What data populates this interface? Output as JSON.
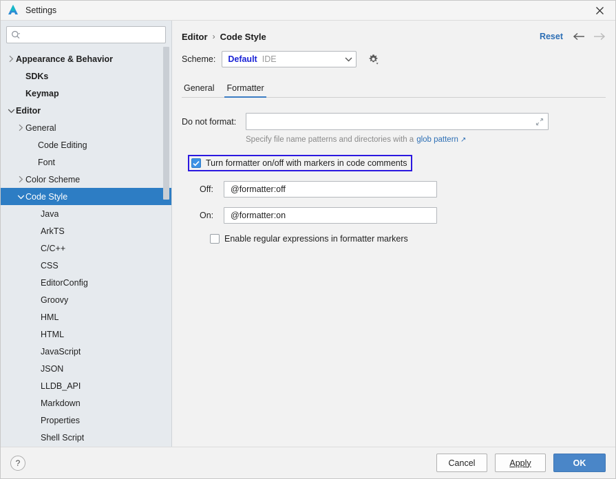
{
  "window": {
    "title": "Settings",
    "logo_icon": "deveco-logo-icon",
    "close_icon": "close-icon"
  },
  "sidebar": {
    "search": {
      "placeholder": "",
      "value": "",
      "icon": "search-icon"
    },
    "items": [
      {
        "label": "Appearance & Behavior",
        "indent": 0,
        "bold": true,
        "twisty": "chevron-right",
        "selected": false
      },
      {
        "label": "SDKs",
        "indent": 1,
        "bold": true,
        "twisty": "none",
        "selected": false
      },
      {
        "label": "Keymap",
        "indent": 1,
        "bold": true,
        "twisty": "none",
        "selected": false
      },
      {
        "label": "Editor",
        "indent": 0,
        "bold": true,
        "twisty": "chevron-down",
        "selected": false
      },
      {
        "label": "General",
        "indent": 1,
        "bold": false,
        "twisty": "chevron-right",
        "selected": false
      },
      {
        "label": "Code Editing",
        "indent": 2,
        "bold": false,
        "twisty": "none",
        "selected": false
      },
      {
        "label": "Font",
        "indent": 2,
        "bold": false,
        "twisty": "none",
        "selected": false
      },
      {
        "label": "Color Scheme",
        "indent": 1,
        "bold": false,
        "twisty": "chevron-right",
        "selected": false
      },
      {
        "label": "Code Style",
        "indent": 1,
        "bold": false,
        "twisty": "chevron-down",
        "selected": true
      },
      {
        "label": "Java",
        "indent": 3,
        "bold": false,
        "twisty": "none",
        "selected": false
      },
      {
        "label": "ArkTS",
        "indent": 3,
        "bold": false,
        "twisty": "none",
        "selected": false
      },
      {
        "label": "C/C++",
        "indent": 3,
        "bold": false,
        "twisty": "none",
        "selected": false
      },
      {
        "label": "CSS",
        "indent": 3,
        "bold": false,
        "twisty": "none",
        "selected": false
      },
      {
        "label": "EditorConfig",
        "indent": 3,
        "bold": false,
        "twisty": "none",
        "selected": false
      },
      {
        "label": "Groovy",
        "indent": 3,
        "bold": false,
        "twisty": "none",
        "selected": false
      },
      {
        "label": "HML",
        "indent": 3,
        "bold": false,
        "twisty": "none",
        "selected": false
      },
      {
        "label": "HTML",
        "indent": 3,
        "bold": false,
        "twisty": "none",
        "selected": false
      },
      {
        "label": "JavaScript",
        "indent": 3,
        "bold": false,
        "twisty": "none",
        "selected": false
      },
      {
        "label": "JSON",
        "indent": 3,
        "bold": false,
        "twisty": "none",
        "selected": false
      },
      {
        "label": "LLDB_API",
        "indent": 3,
        "bold": false,
        "twisty": "none",
        "selected": false
      },
      {
        "label": "Markdown",
        "indent": 3,
        "bold": false,
        "twisty": "none",
        "selected": false
      },
      {
        "label": "Properties",
        "indent": 3,
        "bold": false,
        "twisty": "none",
        "selected": false
      },
      {
        "label": "Shell Script",
        "indent": 3,
        "bold": false,
        "twisty": "none",
        "selected": false
      }
    ]
  },
  "header": {
    "breadcrumb": {
      "parent": "Editor",
      "separator": "›",
      "current": "Code Style"
    },
    "reset_label": "Reset",
    "back_icon": "arrow-left-icon",
    "forward_icon": "arrow-right-icon"
  },
  "scheme": {
    "label": "Scheme:",
    "value": "Default",
    "scope": "IDE",
    "caret_icon": "chevron-down-icon",
    "gear_icon": "gear-icon"
  },
  "tabs": [
    {
      "label": "General",
      "active": false
    },
    {
      "label": "Formatter",
      "active": true
    }
  ],
  "form": {
    "do_not_format": {
      "label": "Do not format:",
      "value": "",
      "placeholder": "",
      "expand_icon": "expand-icon"
    },
    "hint": {
      "text": "Specify file name patterns and directories with a",
      "link": "glob pattern",
      "external_icon": "↗"
    },
    "formatter_markers": {
      "label": "Turn formatter on/off with markers in code comments",
      "checked": true,
      "highlighted": true,
      "highlight_color": "#2b18e0"
    },
    "off": {
      "label": "Off:",
      "value": "@formatter:off"
    },
    "on": {
      "label": "On:",
      "value": "@formatter:on"
    },
    "regex": {
      "label": "Enable regular expressions in formatter markers",
      "checked": false
    }
  },
  "footer": {
    "help_label": "?",
    "cancel_label": "Cancel",
    "apply_label": "Apply",
    "ok_label": "OK",
    "ok_color": "#4a86c8"
  }
}
